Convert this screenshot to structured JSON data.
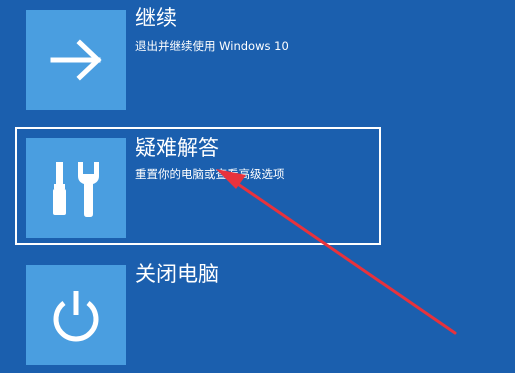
{
  "options": [
    {
      "title": "继续",
      "description": "退出并继续使用 Windows 10",
      "icon": "arrow-right-icon",
      "selected": false
    },
    {
      "title": "疑难解答",
      "description": "重置你的电脑或查看高级选项",
      "icon": "tools-icon",
      "selected": true
    },
    {
      "title": "关闭电脑",
      "description": "",
      "icon": "power-icon",
      "selected": false
    }
  ],
  "colors": {
    "background": "#1b5fae",
    "tile": "#4a9ee0",
    "annotation_arrow": "#e8323c"
  }
}
